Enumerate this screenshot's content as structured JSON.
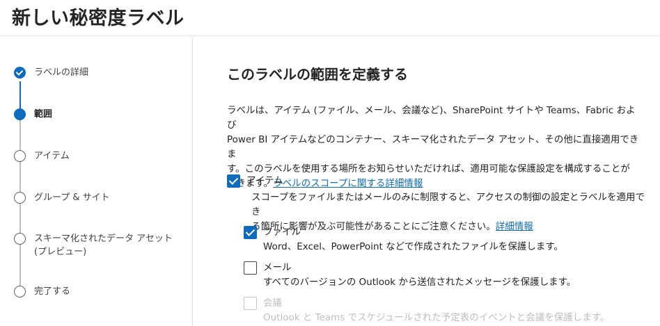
{
  "page": {
    "title": "新しい秘密度ラベル"
  },
  "stepper": {
    "steps": [
      {
        "label": "ラベルの詳細",
        "state": "done"
      },
      {
        "label": "範囲",
        "state": "current"
      },
      {
        "label": "アイテム",
        "state": "pending"
      },
      {
        "label": "グループ & サイト",
        "state": "pending"
      },
      {
        "label_line1": "スキーマ化されたデータ アセット",
        "label_line2": "(プレビュー)",
        "state": "pending"
      },
      {
        "label": "完了する",
        "state": "pending"
      }
    ]
  },
  "main": {
    "section_title": "このラベルの範囲を定義する",
    "description_line1": "ラベルは、アイテム (ファイル、メール、会議など)、SharePoint サイトや Teams、Fabric および",
    "description_line2": "Power BI アイテムなどのコンテナー、スキーマ化されたデータ アセット、その他に直接適用できま",
    "description_line3": "す。このラベルを使用する場所をお知らせいただければ、適用可能な保護設定を構成することが",
    "description_line4_prefix": "できます。",
    "description_link": "ラベルのスコープに関する詳細情報",
    "items_option": {
      "label": "アイテム",
      "checked": true,
      "desc_line1": "スコープをファイルまたはメールのみに制限すると、アクセスの制御の設定とラベルを適用でき",
      "desc_line2": "る箇所に影響が及ぶ可能性があることにご注意ください。",
      "link": "詳細情報"
    },
    "sub_options": [
      {
        "label": "ファイル",
        "checked": true,
        "disabled": false,
        "desc": "Word、Excel、PowerPoint などで作成されたファイルを保護します。"
      },
      {
        "label": "メール",
        "checked": false,
        "disabled": false,
        "desc": "すべてのバージョンの Outlook から送信されたメッセージを保護します。"
      },
      {
        "label": "会議",
        "checked": false,
        "disabled": true,
        "desc": "Outlook と Teams でスケジュールされた予定表のイベントと会議を保護します。"
      }
    ]
  },
  "colors": {
    "accent": "#0f6cbd",
    "text": "#242424",
    "disabled": "#bdbdbd",
    "divider": "#e1e1e1"
  }
}
